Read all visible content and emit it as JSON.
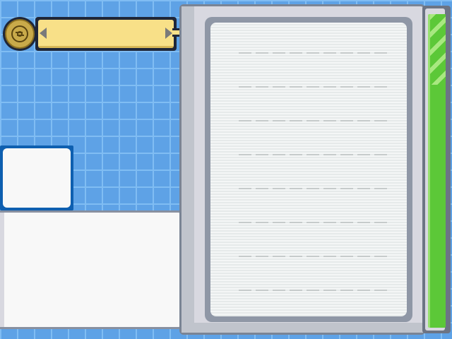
{
  "header": {
    "title": "",
    "dial_icon": "pokeball-dial-icon",
    "prev_icon": "arrow-left-icon",
    "next_icon": "arrow-right-icon"
  },
  "preview": {
    "label": ""
  },
  "description": {
    "text": ""
  },
  "list": {
    "rows": [
      "",
      "",
      "",
      "",
      "",
      "",
      "",
      ""
    ]
  },
  "scrollbar": {
    "position": 0
  },
  "colors": {
    "background": "#5ea2e6",
    "grid": "#80bdf3",
    "banner": "#f8e088",
    "scroll_thumb": "#5cc838",
    "preview_border": "#0e5fb0"
  }
}
